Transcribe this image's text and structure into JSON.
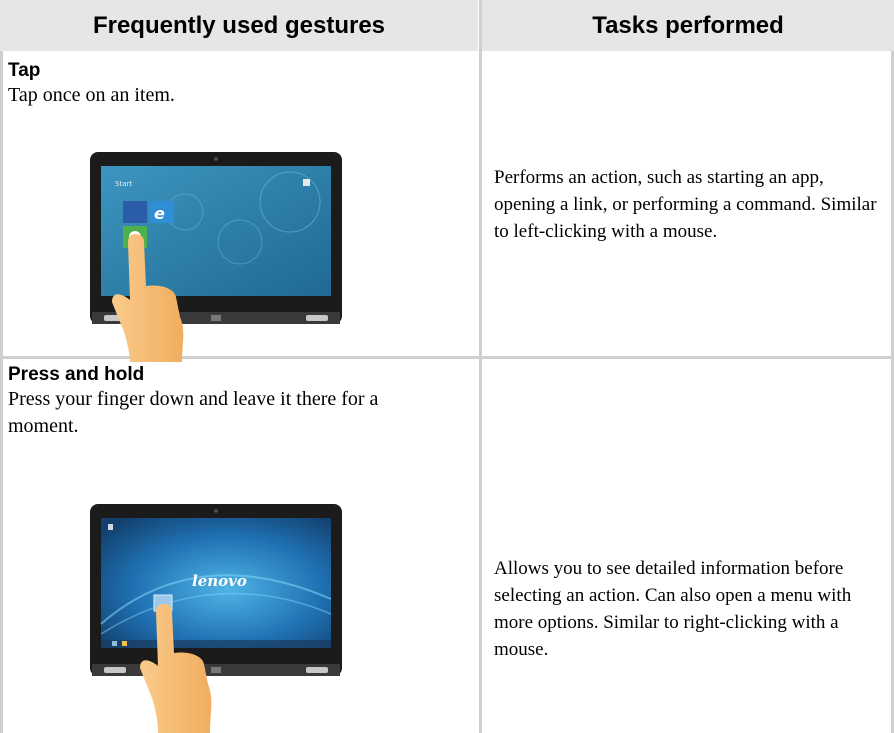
{
  "header": {
    "gestures_col": "Frequently used gestures",
    "tasks_col": "Tasks performed"
  },
  "rows": [
    {
      "title": "Tap",
      "description": "Tap once on an item.",
      "task": "Performs an action, such as starting an app, opening a link, or performing a command. Similar to left-clicking with a mouse.",
      "screen_label": "Start"
    },
    {
      "title": "Press and hold",
      "description": "Press your finger down and leave it there for a moment.",
      "task": "Allows you to see detailed information before selecting an action. Can also open a menu with more options. Similar to right-clicking with a mouse.",
      "screen_label": "lenovo"
    }
  ],
  "colors": {
    "header_bg": "#e6e6e6",
    "divider": "#cfcfcf",
    "screen_blue": "#2f7fa8",
    "finger": "#f7c07a"
  }
}
